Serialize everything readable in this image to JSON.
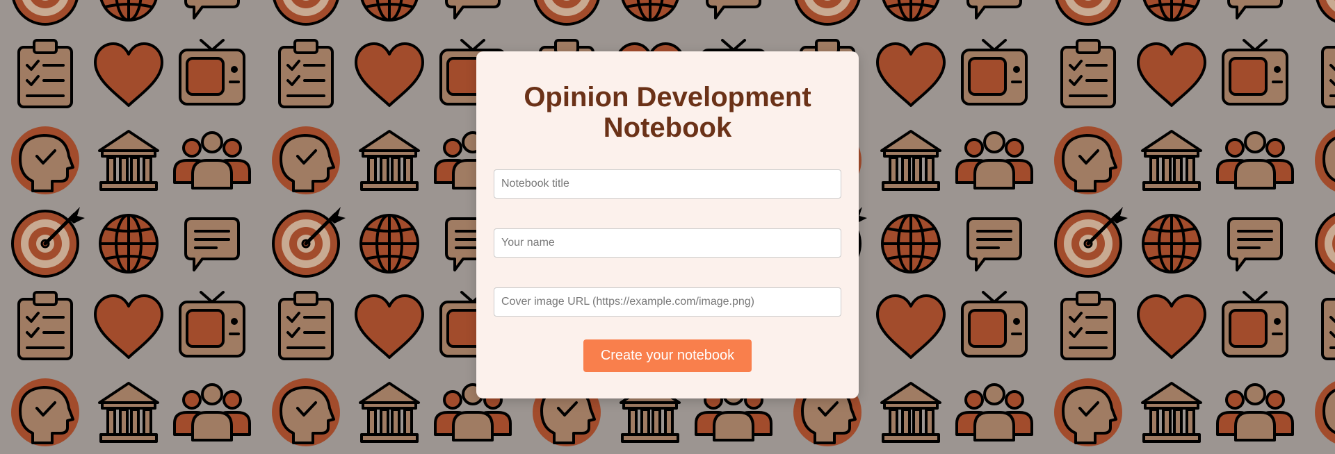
{
  "background": {
    "color": "#9c9591",
    "tile_icons": [
      [
        "target-icon",
        "globe-icon",
        "chat-bubble-icon"
      ],
      [
        "clipboard-checklist-icon",
        "heart-icon",
        "tv-icon"
      ],
      [
        "head-check-icon",
        "institution-icon",
        "people-group-icon"
      ]
    ],
    "palette": {
      "rust": "#a24c2c",
      "tan": "#a07c63",
      "cream": "#c8aa92",
      "ink": "#000000"
    }
  },
  "form": {
    "title": "Opinion Development Notebook",
    "title_color": "#6b3218",
    "card_color": "#fcf1ec",
    "fields": {
      "notebook_title": {
        "placeholder": "Notebook title",
        "value": ""
      },
      "your_name": {
        "placeholder": "Your name",
        "value": ""
      },
      "cover_url": {
        "placeholder": "Cover image URL (https://example.com/image.png)",
        "value": ""
      }
    },
    "submit_label": "Create your notebook",
    "button_color": "#f97f4c"
  }
}
